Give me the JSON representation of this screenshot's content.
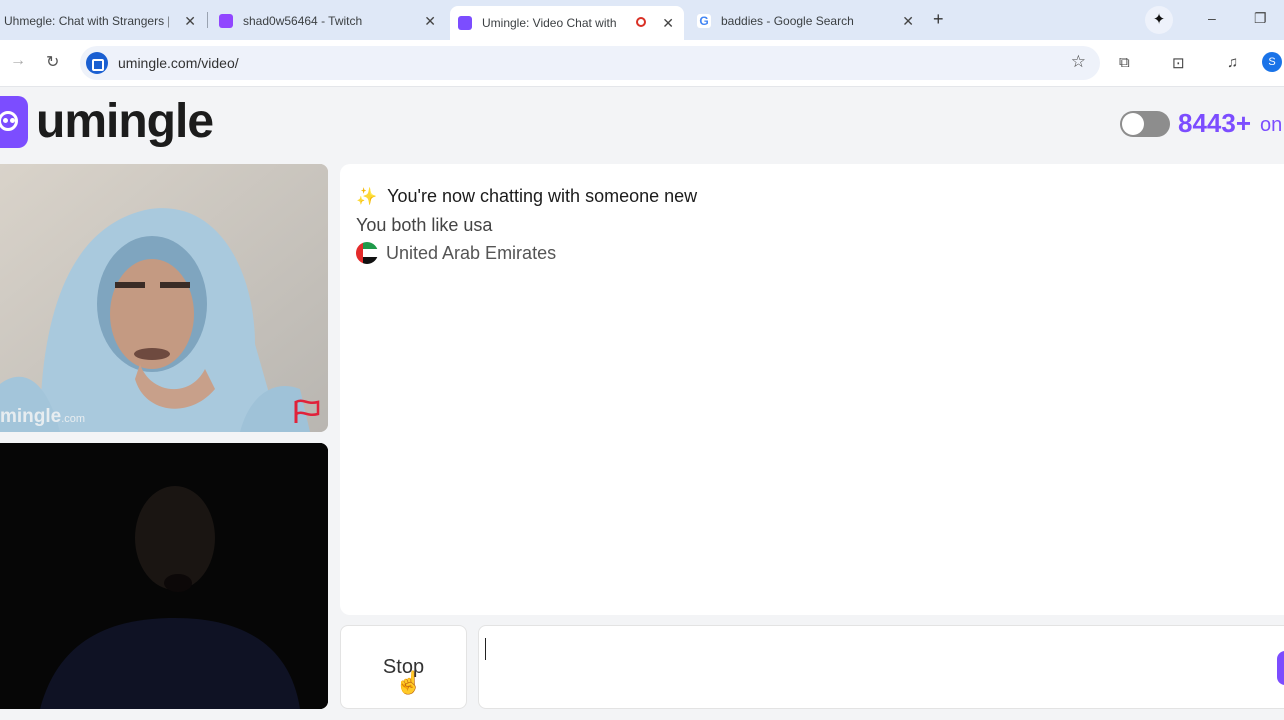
{
  "browser": {
    "tabs": [
      {
        "title": "Uhmegle: Chat with Strangers |",
        "active": false,
        "favicon": "uhmegle-icon"
      },
      {
        "title": "shad0w56464 - Twitch",
        "active": false,
        "favicon": "twitch-icon"
      },
      {
        "title": "Umingle: Video Chat with St",
        "active": true,
        "favicon": "umingle-icon",
        "recording": true
      },
      {
        "title": "baddies - Google Search",
        "active": false,
        "favicon": "google-icon"
      }
    ],
    "url": "umingle.com/video/",
    "profile_initial": "S"
  },
  "header": {
    "logo_text": "umingle",
    "online_count": "8443+",
    "online_suffix": "on",
    "brand_color": "#7c4dff"
  },
  "video": {
    "watermark": "mingle",
    "watermark_suffix": ".com"
  },
  "chat": {
    "line1": "You're now chatting with someone new",
    "line2": "You both like usa",
    "country": "United Arab Emirates"
  },
  "controls": {
    "stop_label": "Stop"
  }
}
